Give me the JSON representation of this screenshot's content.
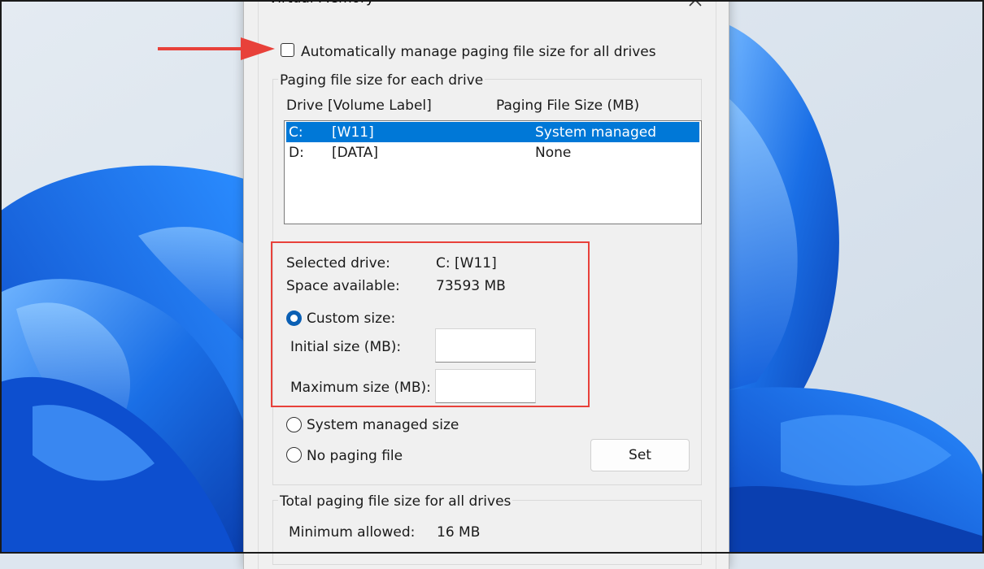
{
  "dialog": {
    "title": "Virtual Memory",
    "auto_manage_label": "Automatically manage paging file size for all drives",
    "auto_manage_checked": false
  },
  "paging_group": {
    "title": "Paging file size for each drive",
    "columns": {
      "drive": "Drive",
      "volume": "[Volume Label]",
      "size": "Paging File Size (MB)"
    },
    "drives": [
      {
        "drive": "C:",
        "volume": "[W11]",
        "size": "System managed",
        "selected": true
      },
      {
        "drive": "D:",
        "volume": "[DATA]",
        "size": "None",
        "selected": false
      }
    ],
    "selected_drive_label": "Selected drive:",
    "selected_drive_value": "C:  [W11]",
    "space_available_label": "Space available:",
    "space_available_value": "73593 MB",
    "custom_size_label": "Custom size:",
    "initial_size_label": "Initial size (MB):",
    "initial_size_value": "",
    "maximum_size_label": "Maximum size (MB):",
    "maximum_size_value": "",
    "system_managed_label": "System managed size",
    "no_paging_label": "No paging file",
    "selected_option": "custom",
    "set_button_label": "Set"
  },
  "total_group": {
    "title": "Total paging file size for all drives",
    "minimum_allowed_label": "Minimum allowed:",
    "minimum_allowed_value": "16 MB"
  },
  "colors": {
    "selection": "#0078d7",
    "radio_checked": "#0a5fb4",
    "annotation_red": "#e8413a",
    "wallpaper_blue": "#1166e0",
    "wallpaper_bg": "#dde6ef"
  }
}
